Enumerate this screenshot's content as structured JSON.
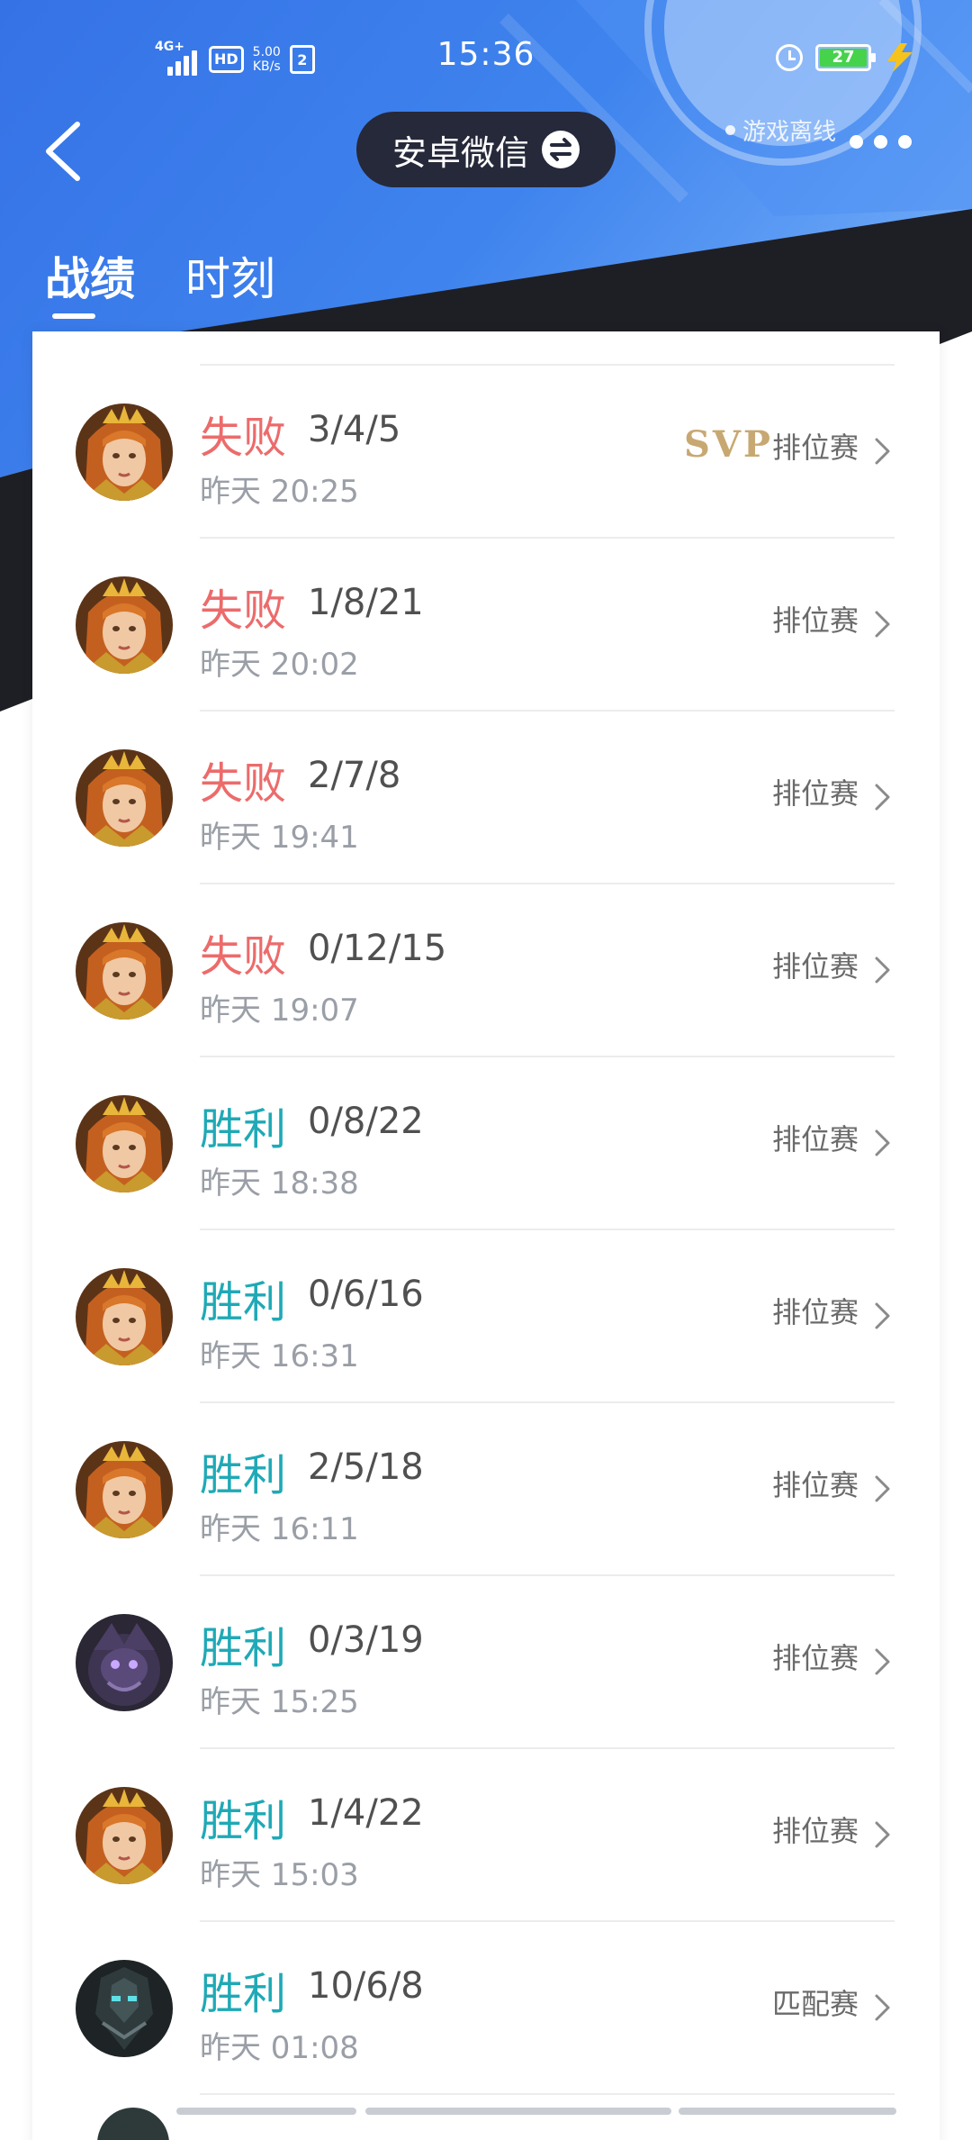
{
  "status_bar": {
    "network_type": "4G+",
    "hd_label": "HD",
    "speed_value": "5.00",
    "speed_unit": "KB/s",
    "time": "15:36",
    "battery_level": "27",
    "icons": [
      "signal-icon",
      "hd-icon",
      "sim-icon",
      "alarm-icon",
      "battery-icon",
      "charging-icon"
    ]
  },
  "header": {
    "account_name": "安卓微信",
    "status_text": "游戏离线"
  },
  "tabs": [
    {
      "label": "战绩",
      "active": true
    },
    {
      "label": "时刻",
      "active": false
    }
  ],
  "matches": [
    {
      "result": "失败",
      "outcome": "lose",
      "kda": "3/4/5",
      "time": "昨天 20:25",
      "badge": "SVP",
      "mode": "排位赛",
      "hero": "hero-a"
    },
    {
      "result": "失败",
      "outcome": "lose",
      "kda": "1/8/21",
      "time": "昨天 20:02",
      "badge": "",
      "mode": "排位赛",
      "hero": "hero-a"
    },
    {
      "result": "失败",
      "outcome": "lose",
      "kda": "2/7/8",
      "time": "昨天 19:41",
      "badge": "",
      "mode": "排位赛",
      "hero": "hero-a"
    },
    {
      "result": "失败",
      "outcome": "lose",
      "kda": "0/12/15",
      "time": "昨天 19:07",
      "badge": "",
      "mode": "排位赛",
      "hero": "hero-a"
    },
    {
      "result": "胜利",
      "outcome": "win",
      "kda": "0/8/22",
      "time": "昨天 18:38",
      "badge": "",
      "mode": "排位赛",
      "hero": "hero-a"
    },
    {
      "result": "胜利",
      "outcome": "win",
      "kda": "0/6/16",
      "time": "昨天 16:31",
      "badge": "",
      "mode": "排位赛",
      "hero": "hero-a"
    },
    {
      "result": "胜利",
      "outcome": "win",
      "kda": "2/5/18",
      "time": "昨天 16:11",
      "badge": "",
      "mode": "排位赛",
      "hero": "hero-a"
    },
    {
      "result": "胜利",
      "outcome": "win",
      "kda": "0/3/19",
      "time": "昨天 15:25",
      "badge": "",
      "mode": "排位赛",
      "hero": "hero-b"
    },
    {
      "result": "胜利",
      "outcome": "win",
      "kda": "1/4/22",
      "time": "昨天 15:03",
      "badge": "",
      "mode": "排位赛",
      "hero": "hero-a"
    },
    {
      "result": "胜利",
      "outcome": "win",
      "kda": "10/6/8",
      "time": "昨天 01:08",
      "badge": "",
      "mode": "匹配赛",
      "hero": "hero-c"
    }
  ],
  "colors": {
    "header_blue": "#3f7ee8",
    "header_dark": "#1d1e24",
    "lose": "#ec6b6b",
    "win": "#1fa9b6",
    "svp_gold": "#c8a872"
  }
}
